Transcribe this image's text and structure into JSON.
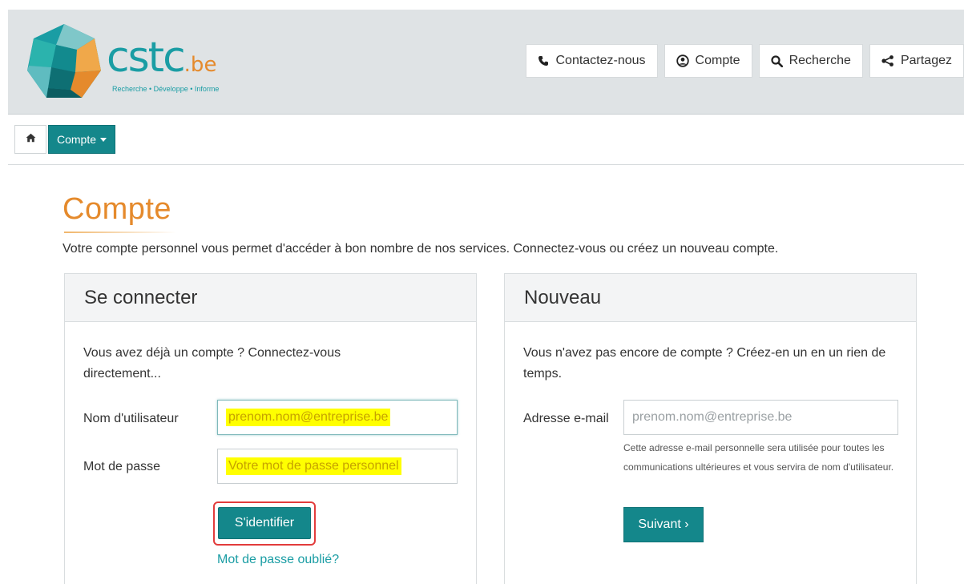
{
  "logo": {
    "name": "cstc",
    "suffix": ".be",
    "tagline": "Recherche • Développe • Informe"
  },
  "topnav": [
    {
      "label": "Contactez-nous",
      "icon": "phone-icon"
    },
    {
      "label": "Compte",
      "icon": "user-circle-icon"
    },
    {
      "label": "Recherche",
      "icon": "search-icon"
    },
    {
      "label": "Partagez",
      "icon": "share-icon"
    }
  ],
  "breadcrumb": {
    "home_icon": "home-icon",
    "current": "Compte"
  },
  "page": {
    "title": "Compte",
    "intro": "Votre compte personnel vous permet d'accéder à bon nombre de nos services. Connectez-vous ou créez un nouveau compte."
  },
  "login": {
    "heading": "Se connecter",
    "description": "Vous avez déjà un compte ? Connectez-vous directement...",
    "username_label": "Nom d'utilisateur",
    "username_placeholder": "prenom.nom@entreprise.be",
    "password_label": "Mot de passe",
    "password_placeholder": "Votre mot de passe personnel",
    "submit_label": "S'identifier",
    "forgot_label": "Mot de passe oublié?"
  },
  "register": {
    "heading": "Nouveau",
    "description": "Vous n'avez pas encore de compte ? Créez-en un en un rien de temps.",
    "email_label": "Adresse e-mail",
    "email_placeholder": "prenom.nom@entreprise.be",
    "help": "Cette adresse e-mail personnelle sera utilisée pour toutes les communications ultérieures et vous servira de nom d'utilisateur.",
    "next_label": "Suivant ›"
  },
  "colors": {
    "teal": "#14878b",
    "orange": "#e58a2c",
    "header_bg": "#dfe3e5"
  }
}
